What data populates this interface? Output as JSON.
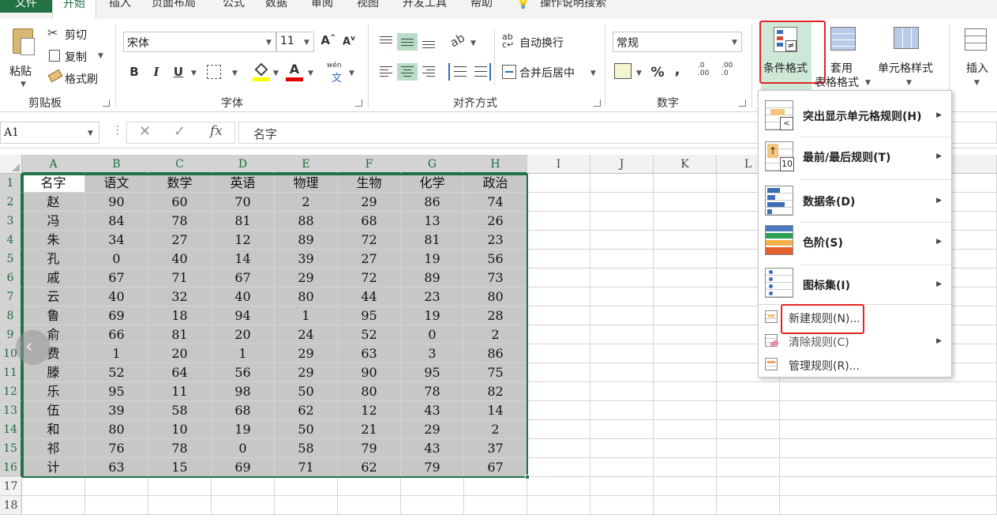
{
  "tabs": [
    "文件",
    "开始",
    "插入",
    "页面布局",
    "公式",
    "数据",
    "审阅",
    "视图",
    "开发工具",
    "帮助"
  ],
  "tell_me": "操作说明搜索",
  "clipboard": {
    "paste": "粘贴",
    "cut": "剪切",
    "copy": "复制",
    "format_painter": "格式刷",
    "group": "剪贴板"
  },
  "font": {
    "name": "宋体",
    "size": "11",
    "group": "字体",
    "bold": "B",
    "italic": "I",
    "underline": "U",
    "grow": "A",
    "shrink": "A",
    "wen": "wén",
    "font_color": "A"
  },
  "alignment": {
    "wrap": "自动换行",
    "merge": "合并后居中",
    "group": "对齐方式"
  },
  "number": {
    "format": "常规",
    "percent": "%",
    "comma": ",",
    "inc": ".0\n.00",
    "dec": ".00\n.0",
    "group": "数字"
  },
  "styles": {
    "conditional": "条件格式",
    "table_format_1": "套用",
    "table_format_2": "表格格式",
    "cell_styles": "单元格样式"
  },
  "cells": {
    "insert": "插入"
  },
  "formula_bar": {
    "name_box": "A1",
    "content": "名字",
    "fx": "fx"
  },
  "columns": [
    "A",
    "B",
    "C",
    "D",
    "E",
    "F",
    "G",
    "H",
    "I",
    "J",
    "K",
    "L"
  ],
  "headers": [
    "名字",
    "语文",
    "数学",
    "英语",
    "物理",
    "生物",
    "化学",
    "政治"
  ],
  "rows": [
    [
      "赵",
      "90",
      "60",
      "70",
      "2",
      "29",
      "86",
      "74"
    ],
    [
      "冯",
      "84",
      "78",
      "81",
      "88",
      "68",
      "13",
      "26"
    ],
    [
      "朱",
      "34",
      "27",
      "12",
      "89",
      "72",
      "81",
      "23"
    ],
    [
      "孔",
      "0",
      "40",
      "14",
      "39",
      "27",
      "19",
      "56"
    ],
    [
      "戚",
      "67",
      "71",
      "67",
      "29",
      "72",
      "89",
      "73"
    ],
    [
      "云",
      "40",
      "32",
      "40",
      "80",
      "44",
      "23",
      "80"
    ],
    [
      "鲁",
      "69",
      "18",
      "94",
      "1",
      "95",
      "19",
      "28"
    ],
    [
      "俞",
      "66",
      "81",
      "20",
      "24",
      "52",
      "0",
      "2"
    ],
    [
      "费",
      "1",
      "20",
      "1",
      "29",
      "63",
      "3",
      "86"
    ],
    [
      "滕",
      "52",
      "64",
      "56",
      "29",
      "90",
      "95",
      "75"
    ],
    [
      "乐",
      "95",
      "11",
      "98",
      "50",
      "80",
      "78",
      "82"
    ],
    [
      "伍",
      "39",
      "58",
      "68",
      "62",
      "12",
      "43",
      "14"
    ],
    [
      "和",
      "80",
      "10",
      "19",
      "50",
      "21",
      "29",
      "2"
    ],
    [
      "祁",
      "76",
      "78",
      "0",
      "58",
      "79",
      "43",
      "37"
    ],
    [
      "计",
      "63",
      "15",
      "69",
      "71",
      "62",
      "79",
      "67"
    ]
  ],
  "row_numbers": [
    "1",
    "2",
    "3",
    "4",
    "5",
    "6",
    "7",
    "8",
    "9",
    "10",
    "11",
    "12",
    "13",
    "14",
    "15",
    "16",
    "17",
    "18"
  ],
  "menu": {
    "items": [
      {
        "label": "突出显示单元格规则(H)",
        "icon": "highlight-rules-icon"
      },
      {
        "label": "最前/最后规则(T)",
        "icon": "top-bottom-rules-icon"
      },
      {
        "label": "数据条(D)",
        "icon": "data-bars-icon"
      },
      {
        "label": "色阶(S)",
        "icon": "color-scales-icon"
      },
      {
        "label": "图标集(I)",
        "icon": "icon-sets-icon"
      }
    ],
    "small_items": [
      {
        "label": "新建规则(N)...",
        "icon": "new-rule-icon"
      },
      {
        "label": "清除规则(C)",
        "icon": "clear-rules-icon"
      },
      {
        "label": "管理规则(R)...",
        "icon": "manage-rules-icon"
      }
    ],
    "top10_badge": "10"
  },
  "colors": {
    "accent": "#217346",
    "selection_fill": "#c7c7c7",
    "highlight": "#e32424"
  }
}
